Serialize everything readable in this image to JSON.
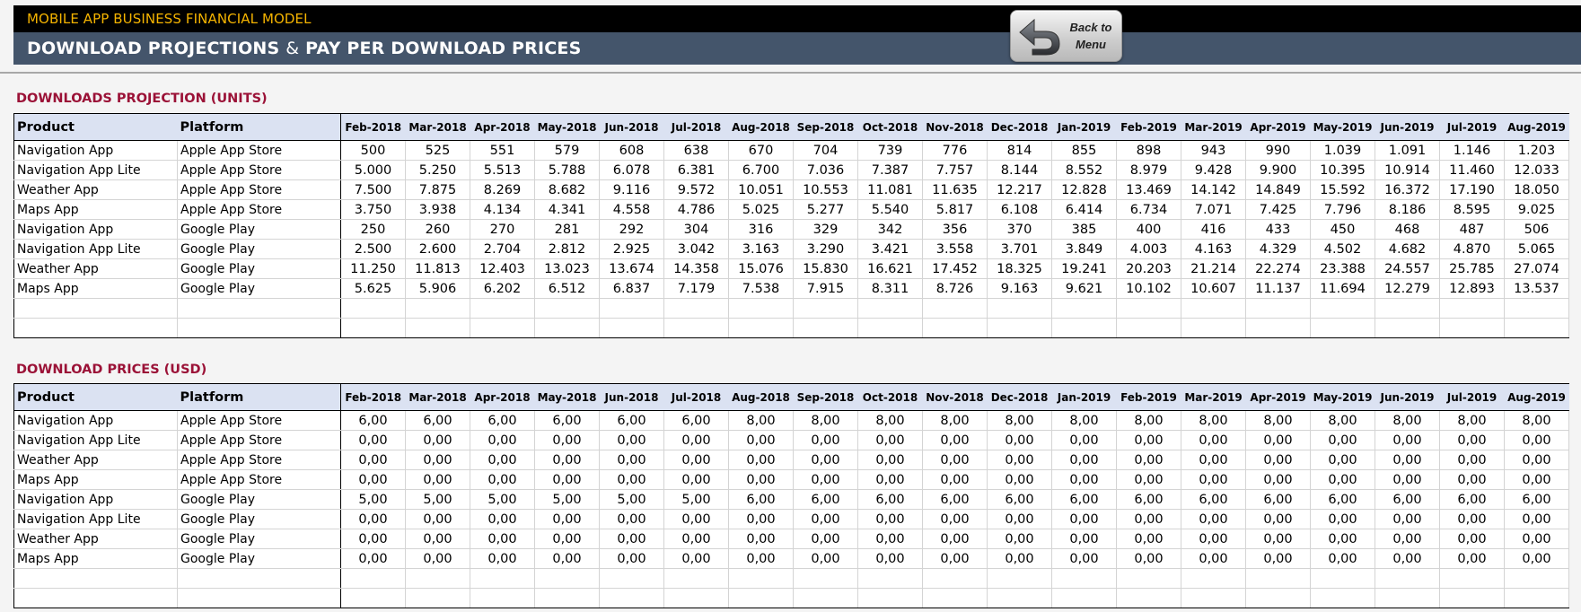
{
  "header": {
    "app_title": "MOBILE APP BUSINESS FINANCIAL MODEL",
    "page_title_part1": "DOWNLOAD PROJECTIONS",
    "page_title_amp": "&",
    "page_title_part2": "PAY PER DOWNLOAD PRICES",
    "back_button": {
      "line1": "Back to",
      "line2": "Menu",
      "icon": "return-arrow-icon"
    }
  },
  "columns": {
    "product": "Product",
    "platform": "Platform",
    "months": [
      "Feb-2018",
      "Mar-2018",
      "Apr-2018",
      "May-2018",
      "Jun-2018",
      "Jul-2018",
      "Aug-2018",
      "Sep-2018",
      "Oct-2018",
      "Nov-2018",
      "Dec-2018",
      "Jan-2019",
      "Feb-2019",
      "Mar-2019",
      "Apr-2019",
      "May-2019",
      "Jun-2019",
      "Jul-2019",
      "Aug-2019"
    ]
  },
  "downloads": {
    "title": "DOWNLOADS PROJECTION (UNITS)",
    "rows": [
      {
        "product": "Navigation App",
        "platform": "Apple App Store",
        "values": [
          "500",
          "525",
          "551",
          "579",
          "608",
          "638",
          "670",
          "704",
          "739",
          "776",
          "814",
          "855",
          "898",
          "943",
          "990",
          "1.039",
          "1.091",
          "1.146",
          "1.203"
        ]
      },
      {
        "product": "Navigation App Lite",
        "platform": "Apple App Store",
        "values": [
          "5.000",
          "5.250",
          "5.513",
          "5.788",
          "6.078",
          "6.381",
          "6.700",
          "7.036",
          "7.387",
          "7.757",
          "8.144",
          "8.552",
          "8.979",
          "9.428",
          "9.900",
          "10.395",
          "10.914",
          "11.460",
          "12.033"
        ]
      },
      {
        "product": "Weather App",
        "platform": "Apple App Store",
        "values": [
          "7.500",
          "7.875",
          "8.269",
          "8.682",
          "9.116",
          "9.572",
          "10.051",
          "10.553",
          "11.081",
          "11.635",
          "12.217",
          "12.828",
          "13.469",
          "14.142",
          "14.849",
          "15.592",
          "16.372",
          "17.190",
          "18.050"
        ]
      },
      {
        "product": "Maps App",
        "platform": "Apple App Store",
        "values": [
          "3.750",
          "3.938",
          "4.134",
          "4.341",
          "4.558",
          "4.786",
          "5.025",
          "5.277",
          "5.540",
          "5.817",
          "6.108",
          "6.414",
          "6.734",
          "7.071",
          "7.425",
          "7.796",
          "8.186",
          "8.595",
          "9.025"
        ]
      },
      {
        "product": "Navigation App",
        "platform": "Google Play",
        "values": [
          "250",
          "260",
          "270",
          "281",
          "292",
          "304",
          "316",
          "329",
          "342",
          "356",
          "370",
          "385",
          "400",
          "416",
          "433",
          "450",
          "468",
          "487",
          "506"
        ]
      },
      {
        "product": "Navigation App Lite",
        "platform": "Google Play",
        "values": [
          "2.500",
          "2.600",
          "2.704",
          "2.812",
          "2.925",
          "3.042",
          "3.163",
          "3.290",
          "3.421",
          "3.558",
          "3.701",
          "3.849",
          "4.003",
          "4.163",
          "4.329",
          "4.502",
          "4.682",
          "4.870",
          "5.065"
        ]
      },
      {
        "product": "Weather App",
        "platform": "Google Play",
        "values": [
          "11.250",
          "11.813",
          "12.403",
          "13.023",
          "13.674",
          "14.358",
          "15.076",
          "15.830",
          "16.621",
          "17.452",
          "18.325",
          "19.241",
          "20.203",
          "21.214",
          "22.274",
          "23.388",
          "24.557",
          "25.785",
          "27.074"
        ]
      },
      {
        "product": "Maps App",
        "platform": "Google Play",
        "values": [
          "5.625",
          "5.906",
          "6.202",
          "6.512",
          "6.837",
          "7.179",
          "7.538",
          "7.915",
          "8.311",
          "8.726",
          "9.163",
          "9.621",
          "10.102",
          "10.607",
          "11.137",
          "11.694",
          "12.279",
          "12.893",
          "13.537"
        ]
      }
    ],
    "empty_rows": 2
  },
  "prices": {
    "title": "DOWNLOAD PRICES (USD)",
    "rows": [
      {
        "product": "Navigation App",
        "platform": "Apple App Store",
        "values": [
          "6,00",
          "6,00",
          "6,00",
          "6,00",
          "6,00",
          "6,00",
          "8,00",
          "8,00",
          "8,00",
          "8,00",
          "8,00",
          "8,00",
          "8,00",
          "8,00",
          "8,00",
          "8,00",
          "8,00",
          "8,00",
          "8,00"
        ]
      },
      {
        "product": "Navigation App Lite",
        "platform": "Apple App Store",
        "values": [
          "0,00",
          "0,00",
          "0,00",
          "0,00",
          "0,00",
          "0,00",
          "0,00",
          "0,00",
          "0,00",
          "0,00",
          "0,00",
          "0,00",
          "0,00",
          "0,00",
          "0,00",
          "0,00",
          "0,00",
          "0,00",
          "0,00"
        ]
      },
      {
        "product": "Weather App",
        "platform": "Apple App Store",
        "values": [
          "0,00",
          "0,00",
          "0,00",
          "0,00",
          "0,00",
          "0,00",
          "0,00",
          "0,00",
          "0,00",
          "0,00",
          "0,00",
          "0,00",
          "0,00",
          "0,00",
          "0,00",
          "0,00",
          "0,00",
          "0,00",
          "0,00"
        ]
      },
      {
        "product": "Maps App",
        "platform": "Apple App Store",
        "values": [
          "0,00",
          "0,00",
          "0,00",
          "0,00",
          "0,00",
          "0,00",
          "0,00",
          "0,00",
          "0,00",
          "0,00",
          "0,00",
          "0,00",
          "0,00",
          "0,00",
          "0,00",
          "0,00",
          "0,00",
          "0,00",
          "0,00"
        ]
      },
      {
        "product": "Navigation App",
        "platform": "Google Play",
        "values": [
          "5,00",
          "5,00",
          "5,00",
          "5,00",
          "5,00",
          "5,00",
          "6,00",
          "6,00",
          "6,00",
          "6,00",
          "6,00",
          "6,00",
          "6,00",
          "6,00",
          "6,00",
          "6,00",
          "6,00",
          "6,00",
          "6,00"
        ]
      },
      {
        "product": "Navigation App Lite",
        "platform": "Google Play",
        "values": [
          "0,00",
          "0,00",
          "0,00",
          "0,00",
          "0,00",
          "0,00",
          "0,00",
          "0,00",
          "0,00",
          "0,00",
          "0,00",
          "0,00",
          "0,00",
          "0,00",
          "0,00",
          "0,00",
          "0,00",
          "0,00",
          "0,00"
        ]
      },
      {
        "product": "Weather App",
        "platform": "Google Play",
        "values": [
          "0,00",
          "0,00",
          "0,00",
          "0,00",
          "0,00",
          "0,00",
          "0,00",
          "0,00",
          "0,00",
          "0,00",
          "0,00",
          "0,00",
          "0,00",
          "0,00",
          "0,00",
          "0,00",
          "0,00",
          "0,00",
          "0,00"
        ]
      },
      {
        "product": "Maps App",
        "platform": "Google Play",
        "values": [
          "0,00",
          "0,00",
          "0,00",
          "0,00",
          "0,00",
          "0,00",
          "0,00",
          "0,00",
          "0,00",
          "0,00",
          "0,00",
          "0,00",
          "0,00",
          "0,00",
          "0,00",
          "0,00",
          "0,00",
          "0,00",
          "0,00"
        ]
      }
    ],
    "empty_rows": 2
  },
  "colors": {
    "title_band": "#000000",
    "app_title": "#f5b400",
    "subtitle_band": "#44556b",
    "section_title": "#9b1237",
    "table_header_bg": "#dbe2f2"
  }
}
